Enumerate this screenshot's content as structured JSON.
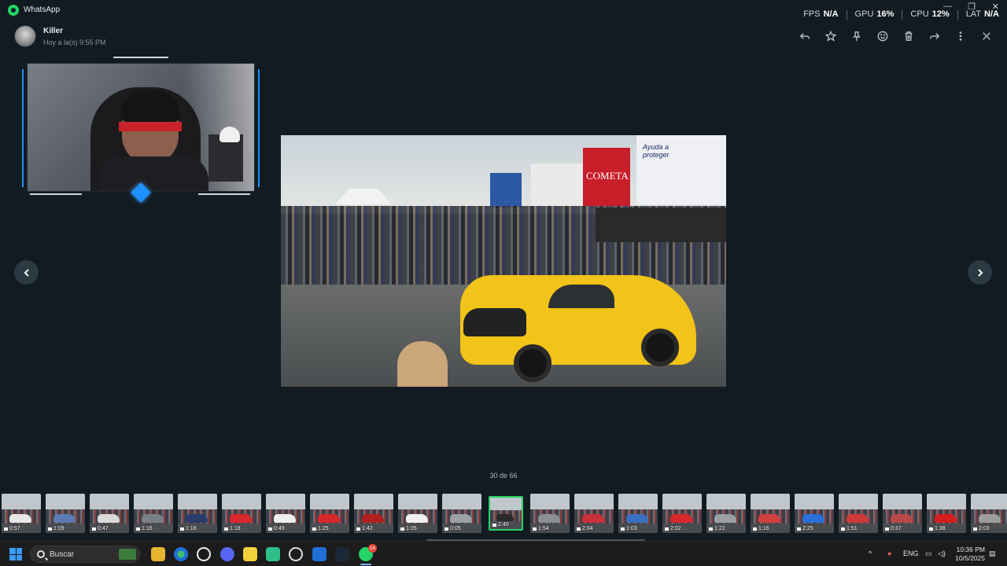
{
  "app": {
    "title": "WhatsApp",
    "accent": "#25d366"
  },
  "window_controls": [
    "—",
    "❐",
    "✕"
  ],
  "perf": {
    "items": [
      {
        "label": "FPS",
        "value": "N/A"
      },
      {
        "label": "GPU",
        "value": "16%"
      },
      {
        "label": "CPU",
        "value": "12%"
      },
      {
        "label": "LAT",
        "value": "N/A"
      }
    ]
  },
  "header": {
    "contact_name": "Killer",
    "timestamp": "Hoy a la(s) 9:55 PM"
  },
  "toolbar": {
    "actions": [
      {
        "name": "reply-icon"
      },
      {
        "name": "star-icon"
      },
      {
        "name": "pin-icon"
      },
      {
        "name": "emoji-icon"
      },
      {
        "name": "delete-icon"
      },
      {
        "name": "forward-icon"
      },
      {
        "name": "more-icon"
      },
      {
        "name": "close-icon"
      }
    ]
  },
  "media": {
    "billboard_brand": "COMETA",
    "billboard_slogan": "Ayuda a proteger"
  },
  "counter": "30 de 66",
  "thumbnails": [
    {
      "duration": "0:57",
      "car": "#e8e8e8"
    },
    {
      "duration": "1:09",
      "car": "#5a7ab0"
    },
    {
      "duration": "0:47",
      "car": "#d9d9d9"
    },
    {
      "duration": "1:16",
      "car": "#7a8088"
    },
    {
      "duration": "1:18",
      "car": "#2a3c6a"
    },
    {
      "duration": "1:18",
      "car": "#d8282c"
    },
    {
      "duration": "0:49",
      "car": "#eeeeee"
    },
    {
      "duration": "1:25",
      "car": "#d62828"
    },
    {
      "duration": "1:42",
      "car": "#b02020"
    },
    {
      "duration": "1:05",
      "car": "#f0f0f0"
    },
    {
      "duration": "0:05",
      "car": "#9aa0a6"
    },
    {
      "duration": "2:40",
      "car": "#2a2a2a",
      "active": true
    },
    {
      "duration": "1:54",
      "car": "#8a8f95"
    },
    {
      "duration": "2:04",
      "car": "#c8303a"
    },
    {
      "duration": "1:03",
      "car": "#3a70c0"
    },
    {
      "duration": "2:02",
      "car": "#d7282c"
    },
    {
      "duration": "1:22",
      "car": "#9aa0a6"
    },
    {
      "duration": "1:16",
      "car": "#d04040"
    },
    {
      "duration": "2:25",
      "car": "#2a6ed8"
    },
    {
      "duration": "1:51",
      "car": "#cc3a3a"
    },
    {
      "duration": "0:37",
      "car": "#b84a4a"
    },
    {
      "duration": "1:38",
      "car": "#d41e1e"
    },
    {
      "duration": "2:03",
      "car": "#9c9c9c"
    }
  ],
  "taskbar": {
    "search_placeholder": "Buscar",
    "whatsapp_badge": "14",
    "language": "ENG",
    "time": "10:36 PM",
    "date": "10/5/2025"
  }
}
